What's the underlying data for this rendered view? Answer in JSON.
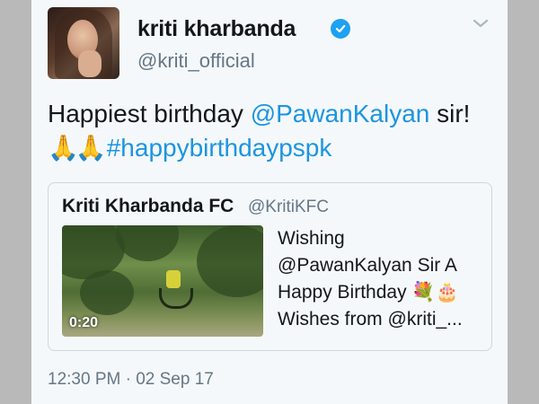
{
  "tweet": {
    "user": {
      "name": "kriti kharbanda",
      "handle": "@kriti_official",
      "verified_icon": "verified-badge-icon"
    },
    "menu_icon": "chevron-down-icon",
    "text": {
      "prefix": "Happiest birthday ",
      "mention": "@PawanKalyan",
      "suffix": " sir!",
      "emoji": "🙏🙏",
      "hashtag": "#happybirthdaypspk"
    },
    "timestamp": "12:30 PM · 02 Sep 17"
  },
  "quoted_tweet": {
    "name": "Kriti Kharbanda FC",
    "handle": "@KritiKFC",
    "video": {
      "duration": "0:20"
    },
    "text_lines": [
      "Wishing",
      "@PawanKalyan Sir A",
      "Happy Birthday 💐🎂",
      "Wishes from @kriti_..."
    ]
  },
  "colors": {
    "link": "#1b95e0",
    "verified": "#1da1f2",
    "secondary_text": "#657786",
    "primary_text": "#14171a"
  }
}
